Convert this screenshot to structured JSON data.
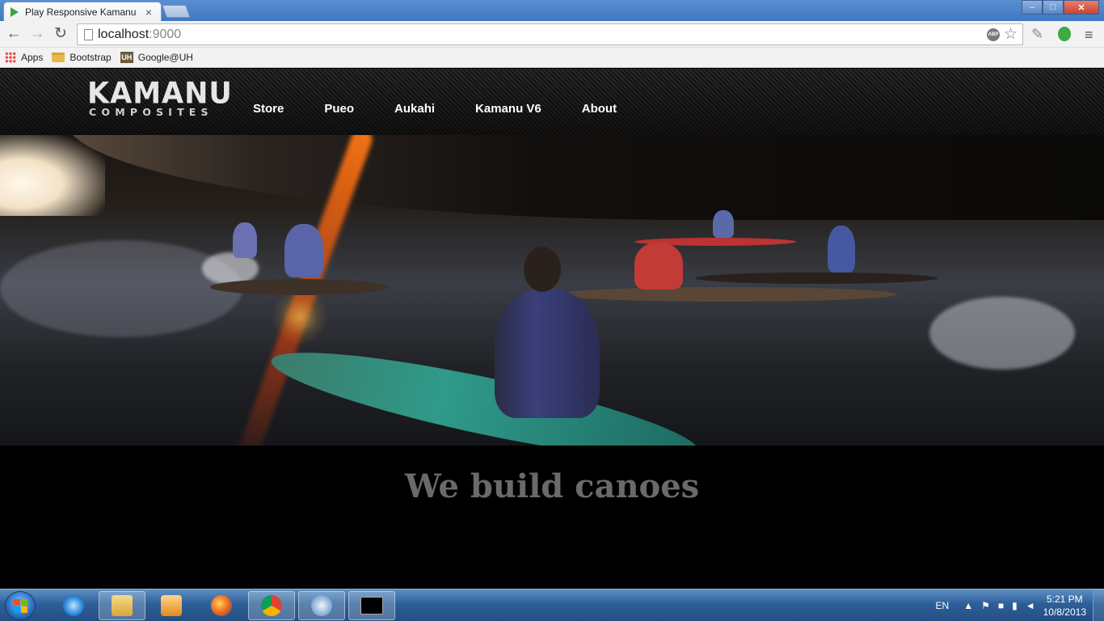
{
  "browser": {
    "tab_title": "Play Responsive Kamanu",
    "tab_close": "×",
    "url_host": "localhost",
    "url_port": ":9000",
    "window_controls": {
      "minimize": "–",
      "maximize": "□",
      "close": "✕"
    },
    "nav": {
      "back": "←",
      "forward": "→",
      "reload": "↻"
    },
    "abp_label": "ABP",
    "star": "☆",
    "menu": "≡",
    "bookmarks": [
      {
        "label": "Apps",
        "icon": "apps-grid-icon"
      },
      {
        "label": "Bootstrap",
        "icon": "folder-icon"
      },
      {
        "label": "Google@UH",
        "icon": "uh-icon",
        "badge": "UH"
      }
    ]
  },
  "site": {
    "logo_main": "KAMANU",
    "logo_sub": "COMPOSITES",
    "nav": [
      "Store",
      "Pueo",
      "Aukahi",
      "Kamanu V6",
      "About"
    ],
    "tagline": "We build canoes"
  },
  "taskbar": {
    "apps": [
      "internet-explorer-icon",
      "file-explorer-icon",
      "media-player-icon",
      "firefox-icon",
      "chrome-icon",
      "app-icon",
      "command-prompt-icon"
    ],
    "language": "EN",
    "time": "5:21 PM",
    "date": "10/8/2013"
  },
  "colors": {
    "tagline": "#6a6a6a",
    "nav_text": "#ffffff",
    "titlebar": "#4a80c6"
  }
}
